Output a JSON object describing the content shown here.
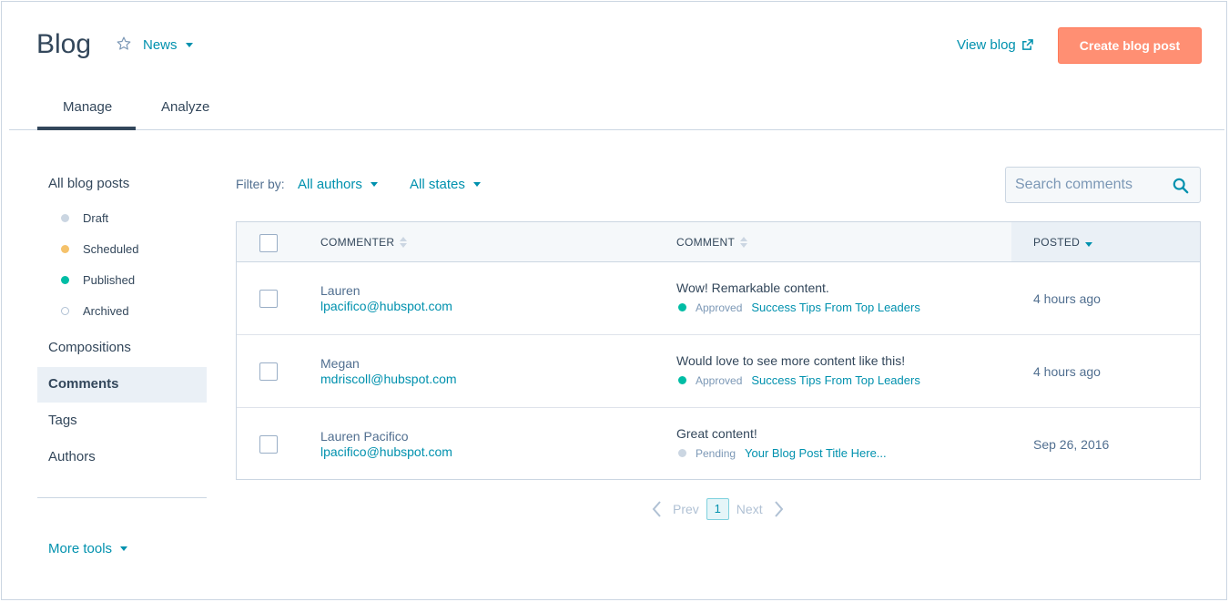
{
  "header": {
    "title": "Blog",
    "blog_select_label": "News",
    "view_blog_label": "View blog",
    "create_button_label": "Create blog post"
  },
  "tabs": [
    {
      "label": "Manage",
      "active": true
    },
    {
      "label": "Analyze",
      "active": false
    }
  ],
  "sidebar": {
    "all_posts_label": "All blog posts",
    "states": [
      {
        "label": "Draft",
        "color": "#cbd6e2"
      },
      {
        "label": "Scheduled",
        "color": "#f5c26b"
      },
      {
        "label": "Published",
        "color": "#00bda5"
      },
      {
        "label": "Archived",
        "color": "#ffffff"
      }
    ],
    "items": [
      {
        "label": "Compositions",
        "active": false
      },
      {
        "label": "Comments",
        "active": true
      },
      {
        "label": "Tags",
        "active": false
      },
      {
        "label": "Authors",
        "active": false
      }
    ],
    "more_tools_label": "More tools"
  },
  "filters": {
    "label": "Filter by:",
    "authors_label": "All authors",
    "states_label": "All states"
  },
  "search": {
    "placeholder": "Search comments"
  },
  "table": {
    "columns": [
      "COMMENTER",
      "COMMENT",
      "POSTED"
    ],
    "sorted_column": "POSTED",
    "rows": [
      {
        "name": "Lauren",
        "email": "lpacifico@hubspot.com",
        "comment": "Wow! Remarkable content.",
        "status": "Approved",
        "status_color": "#00bda5",
        "post": "Success Tips From Top Leaders",
        "posted": "4 hours ago"
      },
      {
        "name": "Megan",
        "email": "mdriscoll@hubspot.com",
        "comment": "Would love to see more content like this!",
        "status": "Approved",
        "status_color": "#00bda5",
        "post": "Success Tips From Top Leaders",
        "posted": "4 hours ago"
      },
      {
        "name": "Lauren Pacifico",
        "email": "lpacifico@hubspot.com",
        "comment": "Great content!",
        "status": "Pending",
        "status_color": "#cbd6e2",
        "post": "Your Blog Post Title Here...",
        "posted": "Sep 26, 2016"
      }
    ]
  },
  "pagination": {
    "prev_label": "Prev",
    "current_page": "1",
    "next_label": "Next"
  },
  "colors": {
    "accent": "#0091ae",
    "primary_button": "#ff8f73",
    "text": "#33475b"
  }
}
